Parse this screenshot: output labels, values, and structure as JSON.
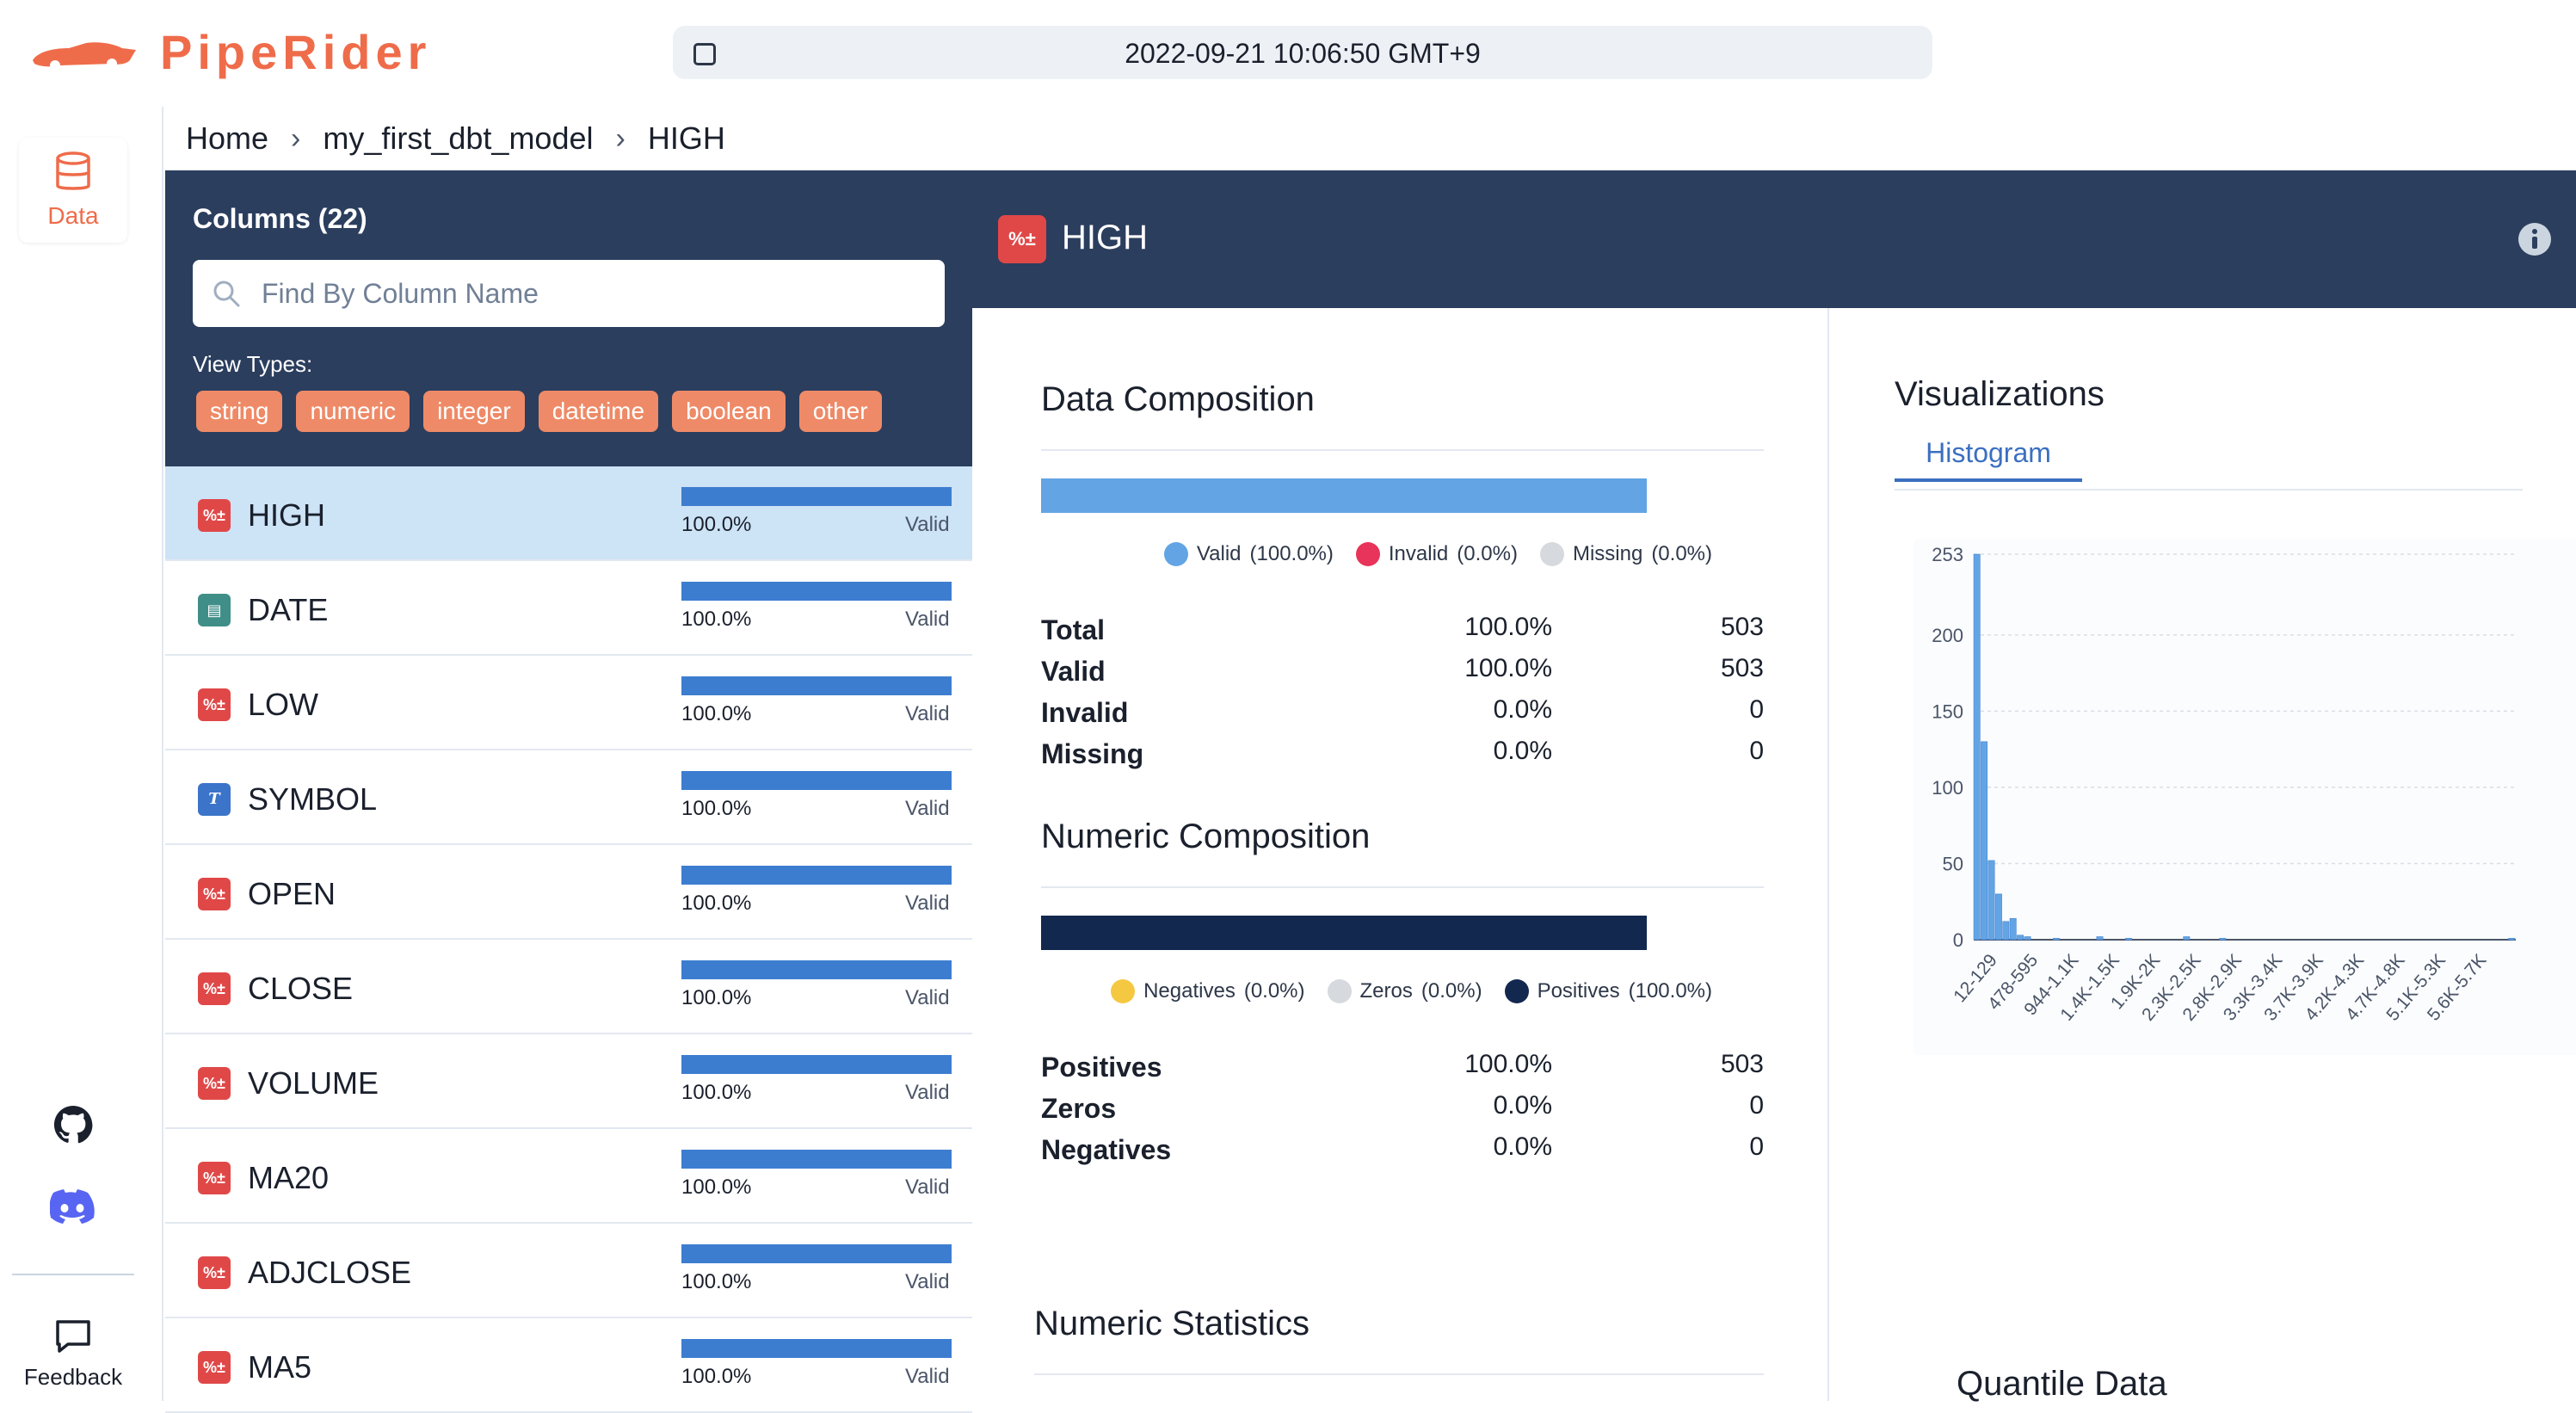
{
  "app": {
    "name": "PipeRider"
  },
  "header": {
    "timestamp": "2022-09-21 10:06:50 GMT+9"
  },
  "rail": {
    "data_label": "Data",
    "feedback_label": "Feedback"
  },
  "breadcrumb": {
    "items": [
      "Home",
      "my_first_dbt_model",
      "HIGH"
    ]
  },
  "columns_panel": {
    "title": "Columns (22)",
    "search_placeholder": "Find By Column Name",
    "search_value": "",
    "view_types_label": "View Types:",
    "types": [
      "string",
      "numeric",
      "integer",
      "datetime",
      "boolean",
      "other"
    ],
    "columns": [
      {
        "name": "HIGH",
        "type": "numeric",
        "pct": "100.0%",
        "status": "Valid",
        "valid_ratio": 1.0,
        "active": true
      },
      {
        "name": "DATE",
        "type": "date",
        "pct": "100.0%",
        "status": "Valid",
        "valid_ratio": 1.0,
        "active": false
      },
      {
        "name": "LOW",
        "type": "numeric",
        "pct": "100.0%",
        "status": "Valid",
        "valid_ratio": 1.0,
        "active": false
      },
      {
        "name": "SYMBOL",
        "type": "string",
        "pct": "100.0%",
        "status": "Valid",
        "valid_ratio": 1.0,
        "active": false
      },
      {
        "name": "OPEN",
        "type": "numeric",
        "pct": "100.0%",
        "status": "Valid",
        "valid_ratio": 1.0,
        "active": false
      },
      {
        "name": "CLOSE",
        "type": "numeric",
        "pct": "100.0%",
        "status": "Valid",
        "valid_ratio": 1.0,
        "active": false
      },
      {
        "name": "VOLUME",
        "type": "numeric",
        "pct": "100.0%",
        "status": "Valid",
        "valid_ratio": 1.0,
        "active": false
      },
      {
        "name": "MA20",
        "type": "numeric",
        "pct": "100.0%",
        "status": "Valid",
        "valid_ratio": 1.0,
        "active": false
      },
      {
        "name": "ADJCLOSE",
        "type": "numeric",
        "pct": "100.0%",
        "status": "Valid",
        "valid_ratio": 1.0,
        "active": false
      },
      {
        "name": "MA5",
        "type": "numeric",
        "pct": "100.0%",
        "status": "Valid",
        "valid_ratio": 1.0,
        "active": false
      }
    ]
  },
  "detail": {
    "title": "HIGH",
    "data_composition": {
      "title": "Data Composition",
      "bar_valid_ratio": 1.0,
      "legend": [
        {
          "label": "Valid",
          "pct": "(100.0%)",
          "color": "#63a4e4"
        },
        {
          "label": "Invalid",
          "pct": "(0.0%)",
          "color": "#e8345a"
        },
        {
          "label": "Missing",
          "pct": "(0.0%)",
          "color": "#d6d9dd"
        }
      ],
      "rows": [
        {
          "label": "Total",
          "pct": "100.0%",
          "count": "503"
        },
        {
          "label": "Valid",
          "pct": "100.0%",
          "count": "503"
        },
        {
          "label": "Invalid",
          "pct": "0.0%",
          "count": "0"
        },
        {
          "label": "Missing",
          "pct": "0.0%",
          "count": "0"
        }
      ]
    },
    "numeric_composition": {
      "title": "Numeric Composition",
      "bar_positive_ratio": 1.0,
      "legend": [
        {
          "label": "Negatives",
          "pct": "(0.0%)",
          "color": "#f5c842"
        },
        {
          "label": "Zeros",
          "pct": "(0.0%)",
          "color": "#d6d9dd"
        },
        {
          "label": "Positives",
          "pct": "(100.0%)",
          "color": "#12284f"
        }
      ],
      "rows": [
        {
          "label": "Positives",
          "pct": "100.0%",
          "count": "503"
        },
        {
          "label": "Zeros",
          "pct": "0.0%",
          "count": "0"
        },
        {
          "label": "Negatives",
          "pct": "0.0%",
          "count": "0"
        }
      ]
    },
    "numeric_statistics_title": "Numeric Statistics",
    "visualizations_title": "Visualizations",
    "tab_histogram": "Histogram",
    "quantile_title": "Quantile Data"
  },
  "colors": {
    "brand": "#ef6c4a",
    "navy": "#2b3e5e",
    "bar_blue": "#3d7dd0",
    "hist_blue": "#63a4e4"
  },
  "chart_data": {
    "type": "bar",
    "ylim": [
      0,
      253
    ],
    "yticks": [
      0,
      50,
      100,
      150,
      200,
      253
    ],
    "x_tick_labels": [
      "12-129",
      "478-595",
      "944-1.1K",
      "1.4K-1.5K",
      "1.9K-2K",
      "2.3K-2.5K",
      "2.8K-2.9K",
      "3.3K-3.4K",
      "3.7K-3.9K",
      "4.2K-4.3K",
      "4.7K-4.8K",
      "5.1K-5.3K",
      "5.6K-5.7K"
    ],
    "values": [
      253,
      130,
      52,
      30,
      12,
      14,
      3,
      2,
      0,
      0,
      0,
      1,
      0,
      0,
      0,
      0,
      0,
      2,
      0,
      0,
      0,
      1,
      0,
      0,
      0,
      0,
      0,
      0,
      0,
      2,
      0,
      0,
      0,
      0,
      1,
      0,
      0,
      0,
      0,
      0,
      0,
      0,
      0,
      0,
      0,
      0,
      0,
      0,
      0,
      0,
      0,
      0,
      0,
      0,
      0,
      0,
      0,
      0,
      0,
      0,
      0,
      0,
      0,
      0,
      0,
      0,
      0,
      0,
      0,
      0,
      0,
      0,
      0,
      0,
      1
    ]
  }
}
